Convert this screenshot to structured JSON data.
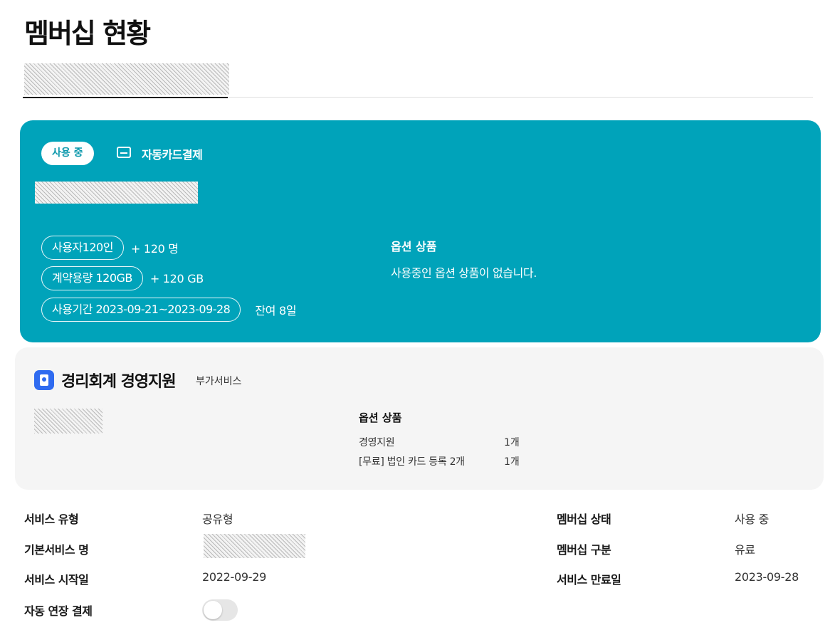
{
  "page": {
    "title": "멤버십 현황"
  },
  "membership_card": {
    "status_badge": "사용 중",
    "payment_method": "자동카드결제",
    "usage": [
      {
        "chip": "사용자120인",
        "extra": "+ 120 명"
      },
      {
        "chip": "계약용량 120GB",
        "extra": "+ 120 GB"
      },
      {
        "chip": "사용기간 2023-09-21~2023-09-28",
        "extra": "잔여 8일"
      }
    ],
    "options_title": "옵션 상품",
    "options_empty": "사용중인 옵션 상품이 없습니다."
  },
  "addon_card": {
    "title": "경리회계 경영지원",
    "subtitle": "부가서비스",
    "options_title": "옵션 상품",
    "options": [
      {
        "name": "경영지원",
        "qty": "1개"
      },
      {
        "name": "[무료] 법인 카드 등록 2개",
        "qty": "1개"
      }
    ]
  },
  "details": {
    "service_type_label": "서비스 유형",
    "service_type_value": "공유형",
    "base_service_label": "기본서비스 명",
    "start_label": "서비스 시작일",
    "start_value": "2022-09-29",
    "auto_renew_label": "자동 연장 결제",
    "auto_renew_on": false,
    "status_label": "멤버십 상태",
    "status_value": "사용 중",
    "category_label": "멤버십 구분",
    "category_value": "유료",
    "end_label": "서비스 만료일",
    "end_value": "2023-09-28"
  },
  "colors": {
    "membership_card": "#00a3ba",
    "addon_icon": "#2f6bf0",
    "addon_card": "#f5f5f5"
  },
  "icons": {
    "payment": "credit-card-icon",
    "addon": "document-app-icon"
  }
}
